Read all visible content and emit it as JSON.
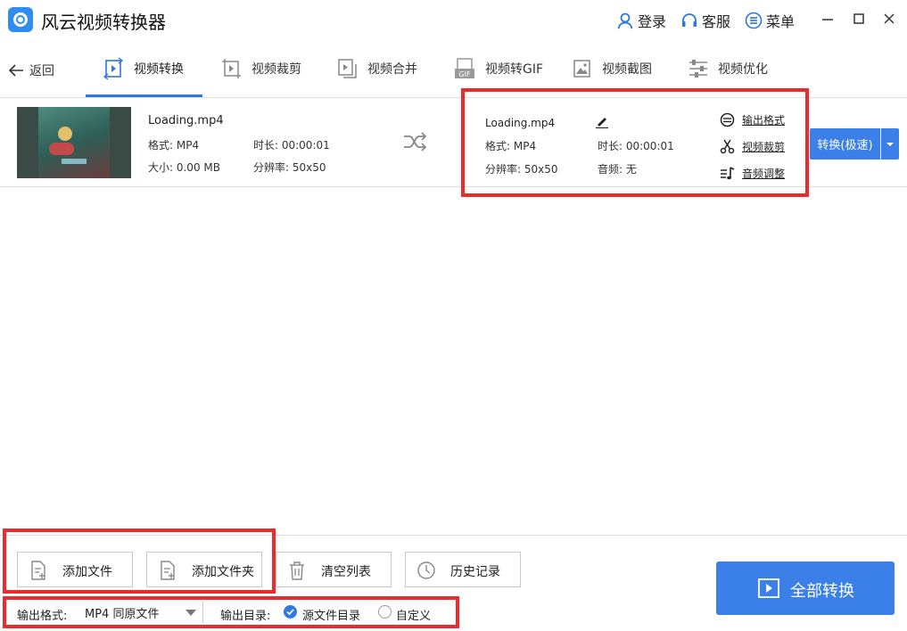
{
  "app": {
    "title": "风云视频转换器"
  },
  "titlebar": {
    "login_label": "登录",
    "service_label": "客服",
    "menu_label": "菜单"
  },
  "nav": {
    "back_label": "返回",
    "tabs": [
      {
        "label": "视频转换",
        "icon": "video-convert-icon",
        "active": true
      },
      {
        "label": "视频裁剪",
        "icon": "video-crop-icon"
      },
      {
        "label": "视频合并",
        "icon": "video-merge-icon"
      },
      {
        "label": "视频转GIF",
        "icon": "gif-icon"
      },
      {
        "label": "视频截图",
        "icon": "screenshot-icon"
      },
      {
        "label": "视频优化",
        "icon": "optimize-icon"
      }
    ],
    "gif_badge": "GIF"
  },
  "file": {
    "source": {
      "name": "Loading.mp4",
      "format": "格式: MP4",
      "duration": "时长: 00:00:01",
      "size": "大小: 0.00 MB",
      "resolution": "分辨率: 50x50"
    },
    "output": {
      "name": "Loading.mp4",
      "format": "格式: MP4",
      "duration": "时长: 00:00:01",
      "resolution": "分辨率: 50x50",
      "audio": "音频: 无"
    },
    "options": {
      "output_format": "输出格式",
      "video_crop": "视频裁剪",
      "audio_adjust": "音频调整"
    },
    "convert_button": "转换(极速)"
  },
  "actions": {
    "add_file": "添加文件",
    "add_folder": "添加文件夹",
    "clear_list": "清空列表",
    "history": "历史记录",
    "convert_all": "全部转换"
  },
  "output_settings": {
    "format_label": "输出格式:",
    "format_value": "MP4 同原文件",
    "dir_label": "输出目录:",
    "dir_options": [
      {
        "label": "源文件目录",
        "checked": true
      },
      {
        "label": "自定义",
        "checked": false
      }
    ]
  },
  "colors": {
    "accent": "#3b7fe8",
    "highlight": "#ec2c2c"
  }
}
